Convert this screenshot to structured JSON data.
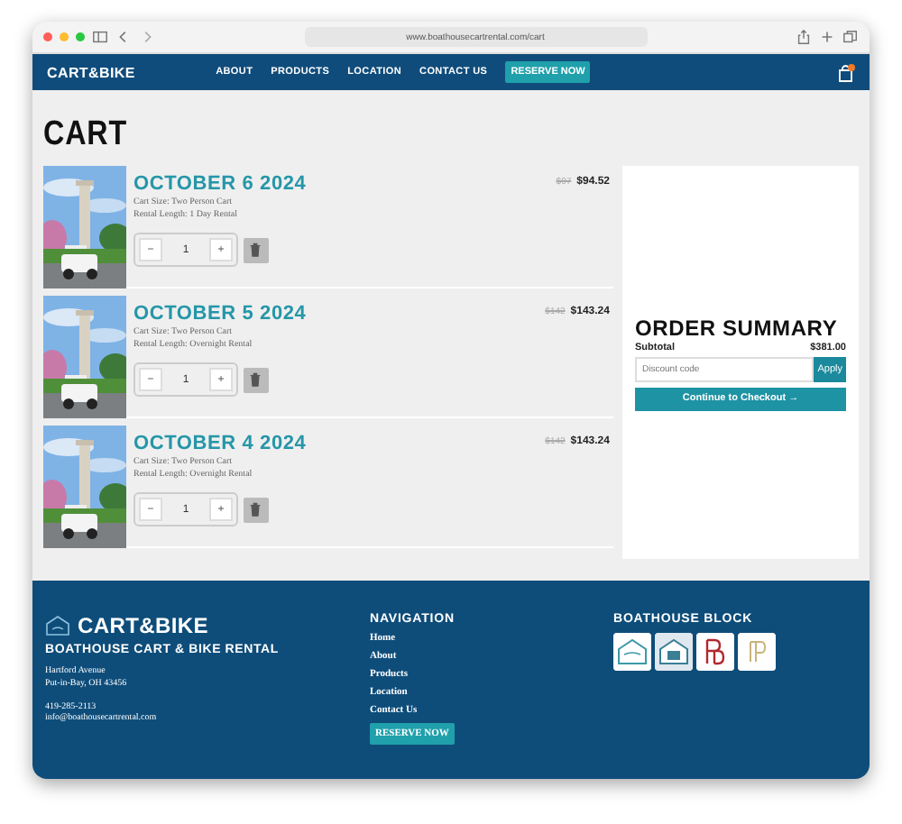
{
  "browser": {
    "url": "www.boathousecartrental.com/cart"
  },
  "nav": {
    "logo": "CART&BIKE",
    "links": [
      "ABOUT",
      "PRODUCTS",
      "LOCATION",
      "CONTACT US"
    ],
    "cta": "RESERVE NOW"
  },
  "page_title": "CART",
  "cart_items": [
    {
      "image": {
        "kind": "picture"
      },
      "title": "OCTOBER 6 2024",
      "details": [
        "Cart Size: Two Person Cart",
        "Rental Length: 1 Day Rental"
      ],
      "decrease": "−",
      "quantity": "1",
      "increase": "+",
      "old_price": "$97",
      "price": "$94.52"
    },
    {
      "image": {
        "kind": "picture"
      },
      "title": "OCTOBER 5 2024",
      "details": [
        "Cart Size: Two Person Cart",
        "Rental Length: Overnight Rental"
      ],
      "decrease": "−",
      "quantity": "1",
      "increase": "+",
      "old_price": "$142",
      "price": "$143.24"
    },
    {
      "image": {
        "kind": "picture"
      },
      "title": "OCTOBER 4 2024",
      "details": [
        "Cart Size: Two Person Cart",
        "Rental Length: Overnight Rental"
      ],
      "decrease": "−",
      "quantity": "1",
      "increase": "+",
      "old_price": "$142",
      "price": "$143.24"
    }
  ],
  "order_summary": {
    "title": "ORDER SUMMARY",
    "subtotal_label": "Subtotal",
    "subtotal": "$381.00",
    "discount_placeholder": "Discount code",
    "apply": "Apply",
    "checkout": "Continue to Checkout →"
  },
  "footer": {
    "logo": "CART&BIKE",
    "tagline": "BOATHOUSE CART & BIKE RENTAL",
    "address": [
      "Hartford Avenue",
      "Put-in-Bay, OH 43456"
    ],
    "contact": [
      "419-285-2113",
      "info@boathousecartrental.com"
    ],
    "nav_title": "NAVIGATION",
    "nav_links": [
      "Home",
      "About",
      "Products",
      "Location",
      "Contact Us"
    ],
    "cta": "RESERVE NOW",
    "block_title": "BOATHOUSE BLOCK"
  }
}
